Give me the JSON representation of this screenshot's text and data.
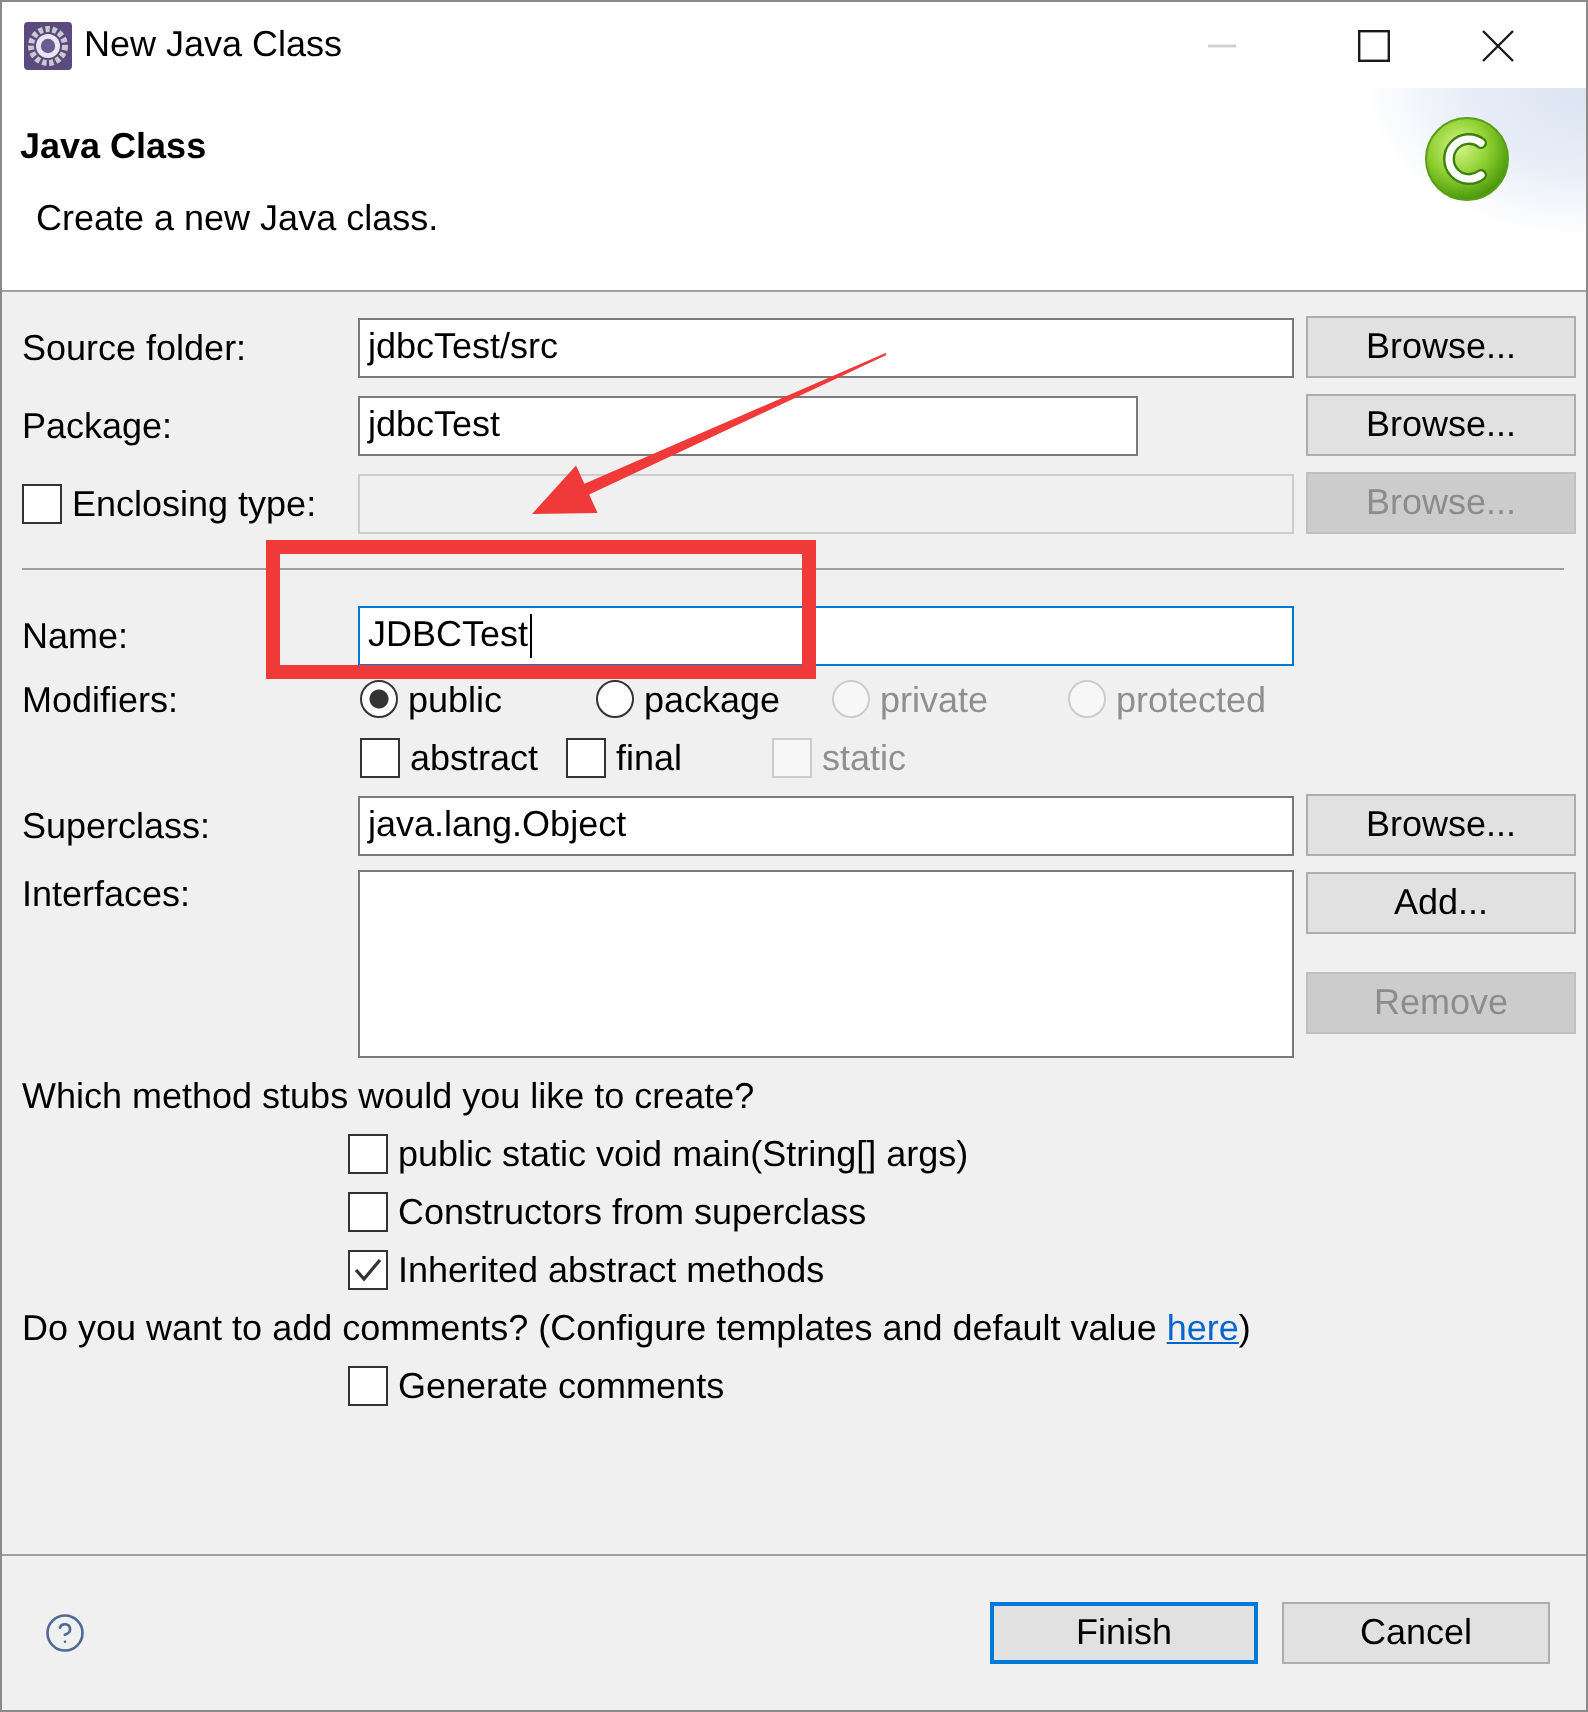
{
  "window": {
    "title": "New Java Class",
    "controls": [
      {
        "kind": "minimize",
        "disabled": true
      },
      {
        "kind": "maximize",
        "disabled": false
      },
      {
        "kind": "close",
        "disabled": false
      }
    ]
  },
  "header": {
    "title": "Java Class",
    "description": "Create a new Java class."
  },
  "location": [
    {
      "kind": "field",
      "label": "Source folder:",
      "value": "jdbcTest/src",
      "disabled": false,
      "button": {
        "label": "Browse...",
        "disabled": false
      }
    },
    {
      "kind": "short_field",
      "label": "Package:",
      "value": "jdbcTest",
      "disabled": false,
      "button": {
        "label": "Browse...",
        "disabled": false
      }
    },
    {
      "kind": "check_field",
      "label": "Enclosing type:",
      "checked": false,
      "disabled": true,
      "button": {
        "label": "Browse...",
        "disabled": true
      }
    }
  ],
  "name": {
    "label": "Name:",
    "value": "JDBCTest",
    "focused": true
  },
  "modifiers": {
    "label": "Modifiers:",
    "access": [
      {
        "label": "public",
        "selected": true,
        "disabled": false
      },
      {
        "label": "package",
        "selected": false,
        "disabled": false
      },
      {
        "label": "private",
        "selected": false,
        "disabled": true
      },
      {
        "label": "protected",
        "selected": false,
        "disabled": true
      }
    ],
    "flags": [
      {
        "label": "abstract",
        "checked": false,
        "disabled": false
      },
      {
        "label": "final",
        "checked": false,
        "disabled": false
      },
      {
        "label": "static",
        "checked": false,
        "disabled": true
      }
    ]
  },
  "superclass": {
    "label": "Superclass:",
    "value": "java.lang.Object",
    "button": {
      "label": "Browse...",
      "disabled": false
    }
  },
  "interfaces": {
    "label": "Interfaces:",
    "buttons": [
      {
        "label": "Add...",
        "disabled": false
      },
      {
        "label": "Remove",
        "disabled": true
      }
    ]
  },
  "method_stubs": {
    "question": "Which method stubs would you like to create?",
    "options": [
      {
        "label": "public static void main(String[] args)",
        "checked": false
      },
      {
        "label": "Constructors from superclass",
        "checked": false
      },
      {
        "label": "Inherited abstract methods",
        "checked": true
      }
    ]
  },
  "comments": {
    "question": "Do you want to add comments? (Configure templates and default value ",
    "link": "here",
    "question_end": ")",
    "options": [
      {
        "label": "Generate comments",
        "checked": false
      }
    ]
  },
  "footer": {
    "buttons": [
      {
        "label": "Finish",
        "default": true
      },
      {
        "label": "Cancel",
        "default": false
      }
    ]
  }
}
